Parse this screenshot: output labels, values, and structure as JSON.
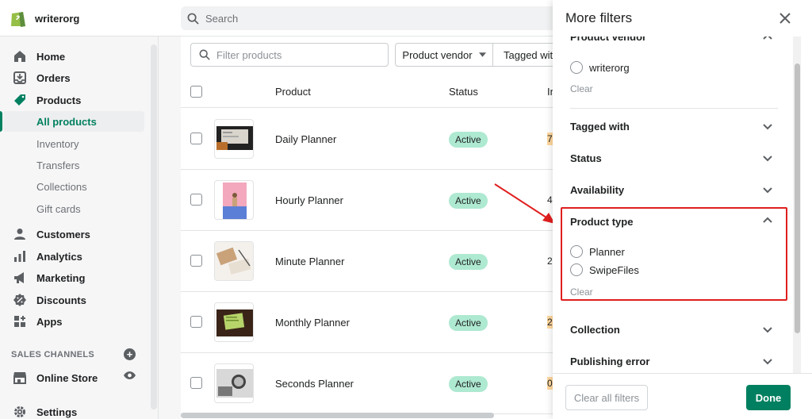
{
  "topbar": {
    "store_name": "writerorg",
    "search_placeholder": "Search"
  },
  "sidebar": {
    "main_items": [
      {
        "label": "Home",
        "icon": "home-icon"
      },
      {
        "label": "Orders",
        "icon": "orders-icon"
      },
      {
        "label": "Products",
        "icon": "tag-icon"
      }
    ],
    "product_sub_items": [
      "All products",
      "Inventory",
      "Transfers",
      "Collections",
      "Gift cards"
    ],
    "more_items": [
      {
        "label": "Customers",
        "icon": "person-icon"
      },
      {
        "label": "Analytics",
        "icon": "bar-chart-icon"
      },
      {
        "label": "Marketing",
        "icon": "megaphone-icon"
      },
      {
        "label": "Discounts",
        "icon": "discount-icon"
      },
      {
        "label": "Apps",
        "icon": "apps-icon"
      }
    ],
    "sales_channels_label": "SALES CHANNELS",
    "online_store": "Online Store",
    "settings": "Settings"
  },
  "main": {
    "filter_placeholder": "Filter products",
    "vendor_button": "Product vendor",
    "tagged_button": "Tagged with",
    "columns": [
      "Product",
      "Status",
      "In"
    ],
    "rows": [
      {
        "name": "Daily Planner",
        "status": "Active",
        "inventory": "7",
        "inv_highlight": true
      },
      {
        "name": "Hourly Planner",
        "status": "Active",
        "inventory": "4",
        "inv_highlight": false
      },
      {
        "name": "Minute Planner",
        "status": "Active",
        "inventory": "2",
        "inv_highlight": false
      },
      {
        "name": "Monthly Planner",
        "status": "Active",
        "inventory": "2",
        "inv_highlight": true
      },
      {
        "name": "Seconds Planner",
        "status": "Active",
        "inventory": "0",
        "inv_highlight": true
      }
    ]
  },
  "drawer": {
    "title": "More filters",
    "vendor_section": {
      "title": "Product vendor",
      "option": "writerorg",
      "clear": "Clear"
    },
    "sections": [
      "Tagged with",
      "Status",
      "Availability"
    ],
    "product_type": {
      "title": "Product type",
      "options": [
        "Planner",
        "SwipeFiles"
      ],
      "clear": "Clear"
    },
    "lower_sections": [
      "Collection",
      "Publishing error"
    ],
    "clear_all": "Clear all filters",
    "done": "Done"
  },
  "colors": {
    "brand_green": "#008060",
    "badge_green": "#aee9d1",
    "annotation_red": "#e01e1e"
  }
}
